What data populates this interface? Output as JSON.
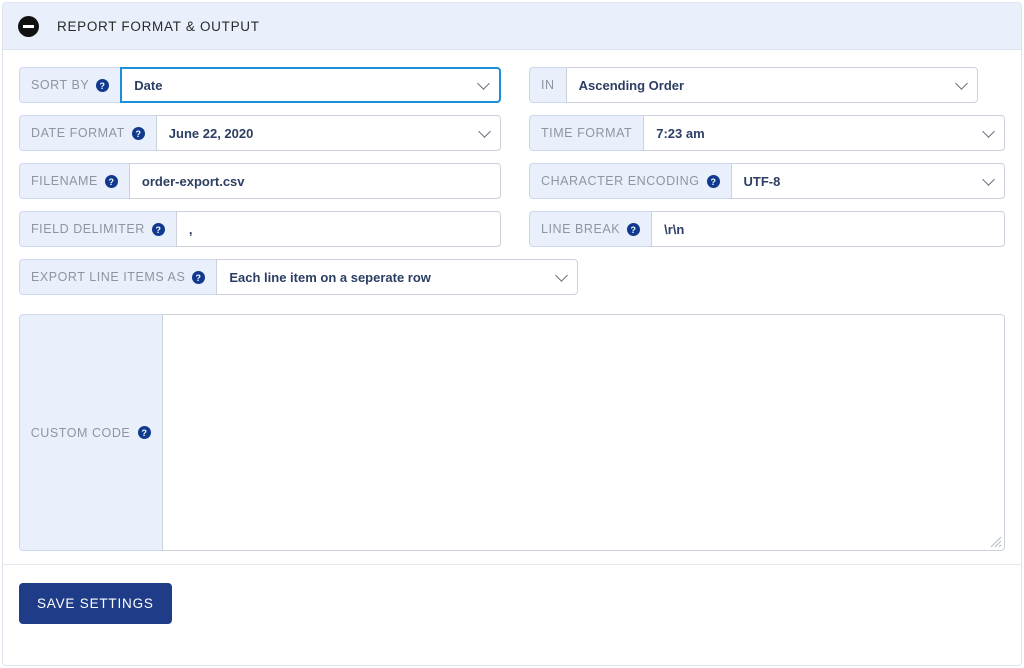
{
  "panel": {
    "title": "REPORT FORMAT & OUTPUT",
    "collapse_icon": "minus-circle-icon",
    "header_bg": "#eaf0fb",
    "accent": "#1f3c88",
    "focus_border": "#1b8fd8"
  },
  "fields": {
    "sort_by": {
      "label": "SORT BY",
      "value": "Date",
      "help": true,
      "type": "select",
      "focused": true
    },
    "in": {
      "label": "IN",
      "value": "Ascending Order",
      "help": false,
      "type": "select",
      "focused": false
    },
    "date_format": {
      "label": "DATE FORMAT",
      "value": "June 22, 2020",
      "help": true,
      "type": "select",
      "focused": false
    },
    "time_format": {
      "label": "TIME FORMAT",
      "value": "7:23 am",
      "help": false,
      "type": "select",
      "focused": false
    },
    "filename": {
      "label": "FILENAME",
      "value": "order-export.csv",
      "help": true,
      "type": "text",
      "placeholder": ""
    },
    "char_encoding": {
      "label": "CHARACTER ENCODING",
      "value": "UTF-8",
      "help": true,
      "type": "select",
      "focused": false
    },
    "field_delimiter": {
      "label": "FIELD DELIMITER",
      "value": ",",
      "help": true,
      "type": "text",
      "placeholder": ""
    },
    "line_break": {
      "label": "LINE BREAK",
      "value": "\\r\\n",
      "help": true,
      "type": "text",
      "placeholder": ""
    },
    "export_line_items": {
      "label": "EXPORT LINE ITEMS AS",
      "value": "Each line item on a seperate row",
      "help": true,
      "type": "select",
      "focused": false
    },
    "custom_code": {
      "label": "CUSTOM CODE",
      "value": "",
      "help": true,
      "type": "textarea",
      "placeholder": ""
    }
  },
  "footer": {
    "save_label": "Save Settings"
  }
}
